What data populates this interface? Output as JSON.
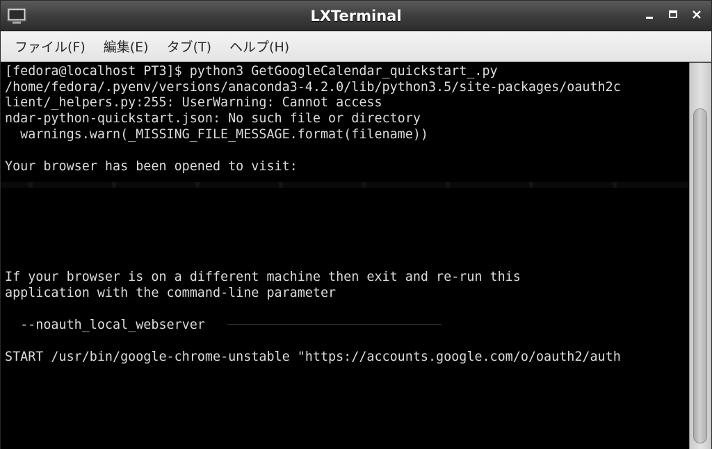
{
  "window": {
    "title": "LXTerminal"
  },
  "menubar": {
    "items": [
      {
        "label": "ファイル(F)"
      },
      {
        "label": "編集(E)"
      },
      {
        "label": "タブ(T)"
      },
      {
        "label": "ヘルプ(H)"
      }
    ]
  },
  "terminal": {
    "lines": [
      "[fedora@localhost PT3]$ python3 GetGoogleCalendar_quickstart_.py",
      "/home/fedora/.pyenv/versions/anaconda3-4.2.0/lib/python3.5/site-packages/oauth2c",
      "lient/_helpers.py:255: UserWarning: Cannot access",
      "ndar-python-quickstart.json: No such file or directory",
      "  warnings.warn(_MISSING_FILE_MESSAGE.format(filename))",
      "Your browser has been opened to visit:",
      "If your browser is on a different machine then exit and re-run this",
      "application with the command-line parameter",
      "  --noauth_local_webserver",
      "START /usr/bin/google-chrome-unstable \"https://accounts.google.com/o/oauth2/auth"
    ]
  },
  "icons": {
    "app": "terminal-icon",
    "minimize": "minimize-icon",
    "maximize": "maximize-icon",
    "close": "close-icon"
  },
  "colors": {
    "terminal_bg": "#000000",
    "terminal_fg": "#dcdcdc",
    "titlebar": "#3e3e3e",
    "menubar": "#ececec"
  }
}
